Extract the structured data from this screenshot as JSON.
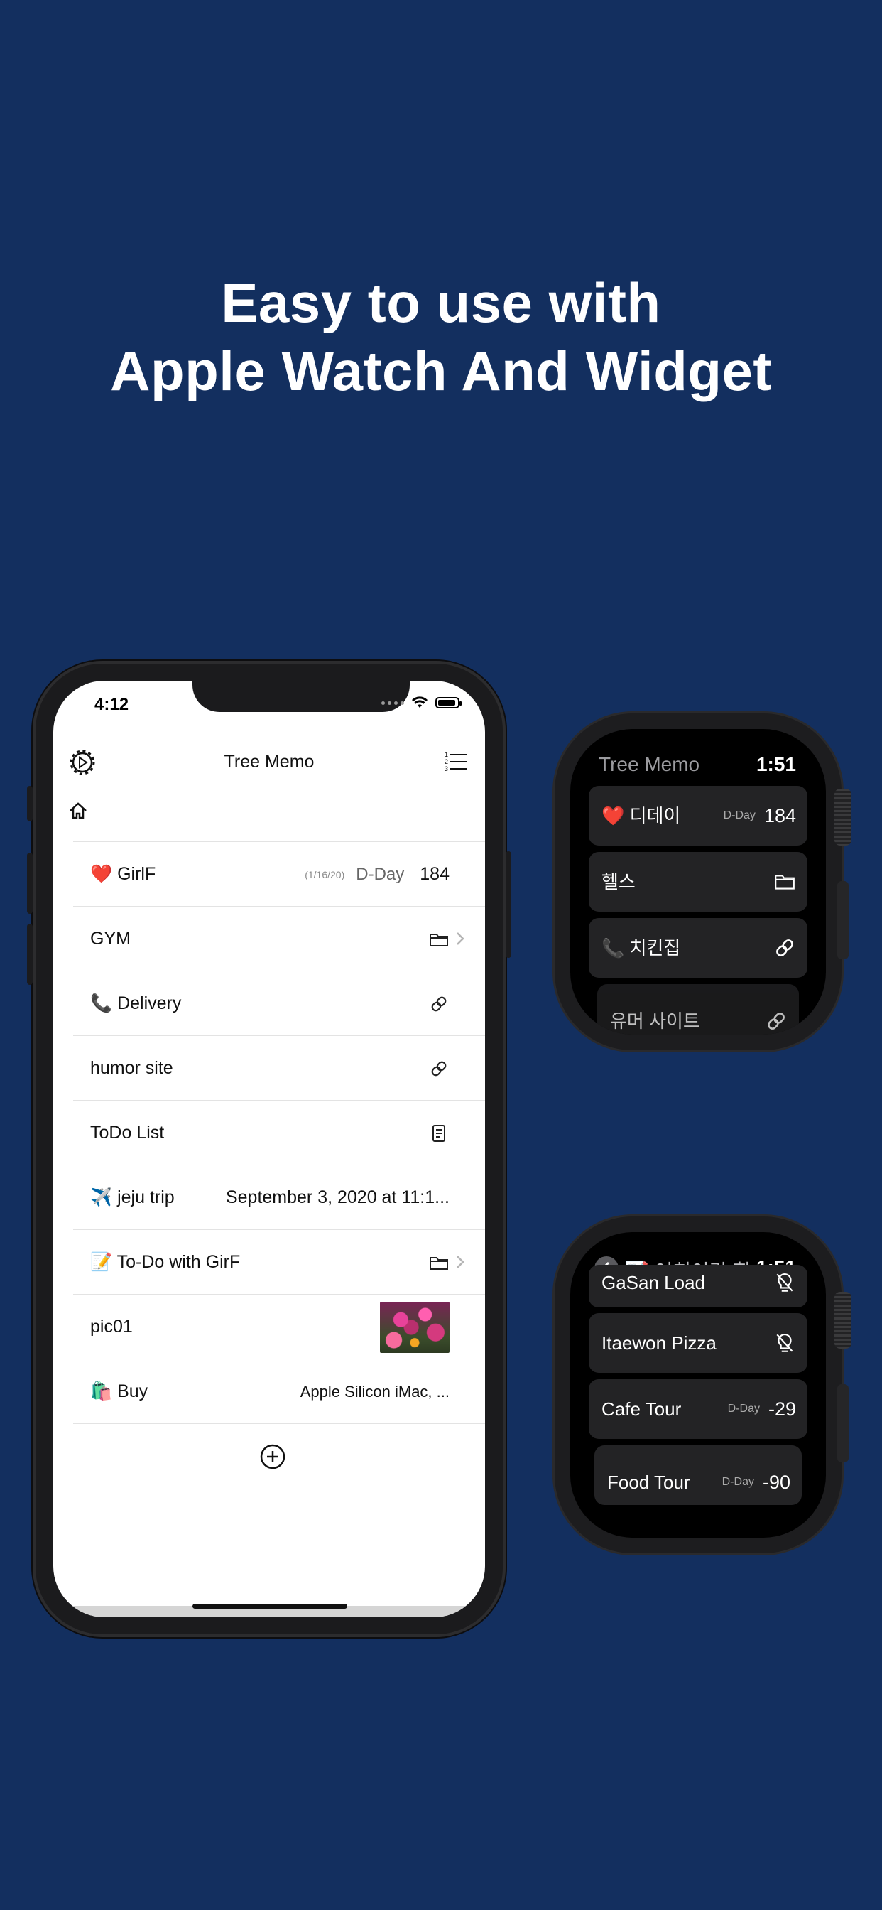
{
  "headline": {
    "line1": "Easy to use with",
    "line2": "Apple Watch And Widget"
  },
  "phone": {
    "status_time": "4:12",
    "nav_title": "Tree Memo",
    "rows": [
      {
        "label": "❤️ GirlF",
        "date_small": "(1/16/20)",
        "dday_label": "D-Day",
        "dday_value": "184"
      },
      {
        "label": "GYM",
        "icon": "folder-icon"
      },
      {
        "label": "📞 Delivery",
        "icon": "link-icon"
      },
      {
        "label": "humor site",
        "icon": "link-icon"
      },
      {
        "label": "ToDo List",
        "icon": "note-icon"
      },
      {
        "label": "✈️ jeju trip",
        "value": "September 3, 2020 at 11:1..."
      },
      {
        "label": "📝 To-Do with GirF",
        "icon": "folder-icon"
      },
      {
        "label": "pic01",
        "icon": "photo-thumbnail"
      },
      {
        "label": "🛍️ Buy",
        "value": "Apple Silicon iMac, ..."
      }
    ]
  },
  "watch1": {
    "title": "Tree Memo",
    "time": "1:51",
    "cells": [
      {
        "label": "❤️ 디데이",
        "dday_label": "D-Day",
        "dday_value": "184"
      },
      {
        "label": "헬스",
        "icon": "folder-icon"
      },
      {
        "label": "📞 치킨집",
        "icon": "link-icon"
      },
      {
        "label": "유머 사이트",
        "icon": "link-icon"
      }
    ]
  },
  "watch2": {
    "title": "📝 여친이랑 할...",
    "time": "1:51",
    "cells": [
      {
        "label": "GaSan Load",
        "icon": "lightbulb-off-icon"
      },
      {
        "label": "Itaewon Pizza",
        "icon": "lightbulb-off-icon"
      },
      {
        "label": "Cafe Tour",
        "dday_label": "D-Day",
        "dday_value": "-29"
      },
      {
        "label": "Food Tour",
        "dday_label": "D-Day",
        "dday_value": "-90"
      }
    ]
  },
  "colors": {
    "background": "#132f5f",
    "phone_body": "#1b1b1d",
    "watch_cell": "#232325"
  }
}
